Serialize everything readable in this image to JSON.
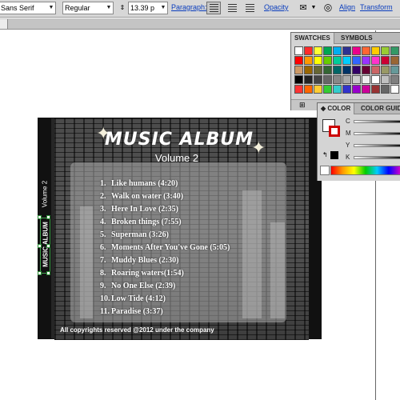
{
  "control_bar": {
    "font_family": "Sans Serif",
    "font_style": "Regular",
    "font_size": "13.39 p",
    "paragraph_label": "Paragraph:",
    "opacity_label": "Opacity",
    "align_label": "Align",
    "transform_label": "Transform"
  },
  "swatches_panel": {
    "tabs": [
      "SWATCHES",
      "SYMBOLS"
    ],
    "swatches": [
      "#ffffff",
      "#ff2a2a",
      "#ffff33",
      "#00a651",
      "#00aeef",
      "#2e3192",
      "#ec008c",
      "#ff6633",
      "#ffcc00",
      "#99cc33",
      "#339966",
      "#ff0000",
      "#ff9900",
      "#ffff00",
      "#66cc00",
      "#00cc99",
      "#00ccff",
      "#3366ff",
      "#9933ff",
      "#ff33cc",
      "#cc0033",
      "#996633",
      "#cc9966",
      "#996600",
      "#666633",
      "#336633",
      "#006666",
      "#003366",
      "#330066",
      "#660033",
      "#cc6666",
      "#999966",
      "#669999",
      "#000000",
      "#222222",
      "#444444",
      "#666666",
      "#888888",
      "#aaaaaa",
      "#cccccc",
      "#eeeeee",
      "#ffffff",
      "#c0c0c0",
      "#808080",
      "#ff3333",
      "#ff6600",
      "#ffcc33",
      "#33cc33",
      "#33cccc",
      "#3333cc",
      "#9900cc",
      "#cc0099",
      "#993333",
      "#666666",
      "#ffffff"
    ]
  },
  "color_panel": {
    "tabs": [
      "COLOR",
      "COLOR GUID"
    ],
    "channels": [
      "C",
      "M",
      "Y",
      "K"
    ]
  },
  "album": {
    "title": "MUSIC ALBUM",
    "subtitle": "Volume 2",
    "spine_text": "Volume 2",
    "spine_logo": "MUSIC ALBUM",
    "tracks": [
      {
        "num": "1.",
        "title": "Like humans (4:20)"
      },
      {
        "num": "2.",
        "title": "Walk on water (3:40)"
      },
      {
        "num": "3.",
        "title": "Here In Love (2:35)"
      },
      {
        "num": "4.",
        "title": "Broken things (7:55)"
      },
      {
        "num": "5.",
        "title": "Superman (3:26)"
      },
      {
        "num": "6.",
        "title": "Moments After You've Gone (5:05)"
      },
      {
        "num": "7.",
        "title": "Muddy Blues (2:30)"
      },
      {
        "num": "8.",
        "title": "Roaring waters(1:54)"
      },
      {
        "num": "9.",
        "title": "No One Else (2:39)"
      },
      {
        "num": "10.",
        "title": "Low Tide (4:12)"
      },
      {
        "num": "11.",
        "title": "Paradise (3:37)"
      }
    ],
    "copyright": "All copyrights reserved @2012 under the company"
  },
  "icons": {
    "align_left": "align-left-icon",
    "align_center": "align-center-icon",
    "align_right": "align-right-icon",
    "globe": "globe-icon",
    "envelope": "envelope-icon"
  }
}
